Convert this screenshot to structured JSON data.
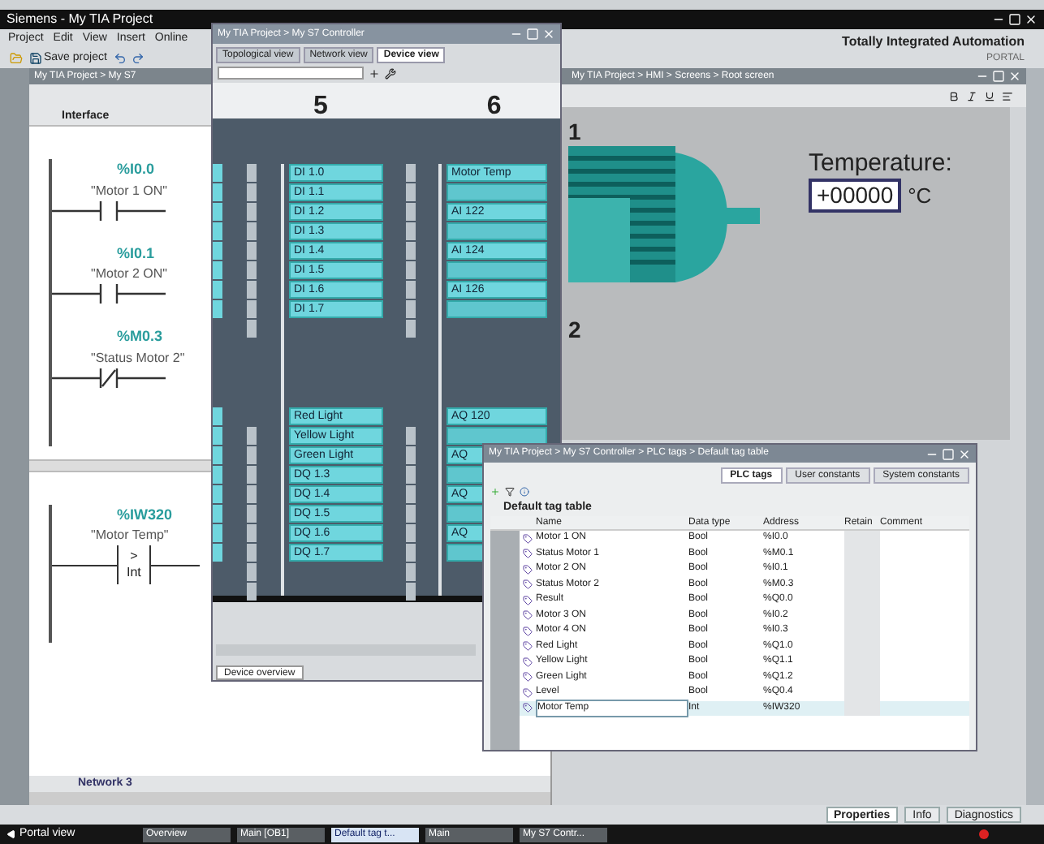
{
  "app_title": "Siemens - My TIA Project",
  "menu": [
    "Project",
    "Edit",
    "View",
    "Insert",
    "Online"
  ],
  "toolbar": {
    "save_label": "Save project"
  },
  "brand": {
    "title": "Totally Integrated Automation",
    "subtitle": "PORTAL"
  },
  "editor": {
    "breadcrumb": "My TIA Project > My S7",
    "section": "Interface",
    "networks": [
      {
        "rungs": [
          {
            "kind": "no",
            "address": "%I0.0",
            "tag": "\"Motor 1 ON\""
          },
          {
            "kind": "no",
            "address": "%I0.1",
            "tag": "\"Motor 2 ON\""
          },
          {
            "kind": "nc",
            "address": "%M0.3",
            "tag": "\"Status Motor 2\""
          }
        ]
      },
      {
        "rungs": [
          {
            "kind": "compare",
            "address": "%IW320",
            "tag": "\"Motor Temp\"",
            "op": ">",
            "type": "Int"
          }
        ]
      }
    ],
    "next_network": "Network 3"
  },
  "hmi": {
    "breadcrumb": "My TIA Project > HMI > Screens > Root screen",
    "markers": [
      "1",
      "2"
    ],
    "temperature_label": "Temperature:",
    "value": "+00000",
    "unit": "°C"
  },
  "device_window": {
    "title": "My TIA Project > My S7 Controller",
    "tabs": [
      {
        "label": "Topological view",
        "selected": false
      },
      {
        "label": "Network view",
        "selected": false
      },
      {
        "label": "Device view",
        "selected": true
      }
    ],
    "slots": [
      "5",
      "6"
    ],
    "modules": [
      {
        "groups": [
          [
            {
              "label": "DI 1.0"
            },
            {
              "label": "DI 1.1"
            },
            {
              "label": "DI 1.2"
            },
            {
              "label": "DI 1.3"
            },
            {
              "label": "DI 1.4"
            },
            {
              "label": "DI 1.5"
            },
            {
              "label": "DI 1.6"
            },
            {
              "label": "DI 1.7"
            }
          ],
          [
            {
              "label": "Red Light"
            },
            {
              "label": "Yellow Light"
            },
            {
              "label": "Green Light"
            },
            {
              "label": "DQ 1.3"
            },
            {
              "label": "DQ 1.4"
            },
            {
              "label": "DQ 1.5"
            },
            {
              "label": "DQ 1.6"
            },
            {
              "label": "DQ 1.7"
            }
          ]
        ]
      },
      {
        "groups": [
          [
            {
              "kind": "label",
              "label": "Motor Temp"
            },
            {
              "kind": "blank"
            },
            {
              "kind": "label",
              "label": "AI 122"
            },
            {
              "kind": "blank"
            },
            {
              "kind": "label",
              "label": "AI 124"
            },
            {
              "kind": "blank"
            },
            {
              "kind": "label",
              "label": "AI 126"
            },
            {
              "kind": "blank"
            }
          ],
          [
            {
              "kind": "label",
              "label": "AQ 120"
            },
            {
              "kind": "blank"
            },
            {
              "kind": "label",
              "label": "AQ"
            },
            {
              "kind": "blank"
            },
            {
              "kind": "label",
              "label": "AQ"
            },
            {
              "kind": "blank"
            },
            {
              "kind": "label",
              "label": "AQ"
            },
            {
              "kind": "blank"
            }
          ]
        ]
      }
    ],
    "overview_tab": "Device overview"
  },
  "tag_window": {
    "title": "My TIA Project > My S7 Controller > PLC tags > Default tag table",
    "tabs": [
      {
        "label": "PLC tags",
        "selected": true
      },
      {
        "label": "User constants",
        "selected": false
      },
      {
        "label": "System constants",
        "selected": false
      }
    ],
    "heading": "Default tag table",
    "columns": [
      "Name",
      "Data type",
      "Address",
      "Retain",
      "Comment"
    ],
    "rows": [
      {
        "name": "Motor 1 ON",
        "data_type": "Bool",
        "address": "%I0.0",
        "selected": false
      },
      {
        "name": "Status Motor 1",
        "data_type": "Bool",
        "address": "%M0.1",
        "selected": false
      },
      {
        "name": "Motor 2 ON",
        "data_type": "Bool",
        "address": "%I0.1",
        "selected": false
      },
      {
        "name": "Status Motor 2",
        "data_type": "Bool",
        "address": "%M0.3",
        "selected": false
      },
      {
        "name": "Result",
        "data_type": "Bool",
        "address": "%Q0.0",
        "selected": false
      },
      {
        "name": "Motor 3 ON",
        "data_type": "Bool",
        "address": "%I0.2",
        "selected": false
      },
      {
        "name": "Motor 4 ON",
        "data_type": "Bool",
        "address": "%I0.3",
        "selected": false
      },
      {
        "name": "Red Light",
        "data_type": "Bool",
        "address": "%Q1.0",
        "selected": false
      },
      {
        "name": "Yellow Light",
        "data_type": "Bool",
        "address": "%Q1.1",
        "selected": false
      },
      {
        "name": "Green Light",
        "data_type": "Bool",
        "address": "%Q1.2",
        "selected": false
      },
      {
        "name": "Level",
        "data_type": "Bool",
        "address": "%Q0.4",
        "selected": false
      },
      {
        "name": "Motor Temp",
        "data_type": "Int",
        "address": "%IW320",
        "selected": true
      }
    ]
  },
  "status_panels": [
    {
      "label": "Properties",
      "selected": true
    },
    {
      "label": "Info",
      "selected": false
    },
    {
      "label": "Diagnostics",
      "selected": false
    }
  ],
  "taskbar": {
    "portal_view": "Portal view",
    "items": [
      {
        "label": "Overview",
        "selected": false
      },
      {
        "label": "Main [OB1]",
        "selected": false
      },
      {
        "label": "Default tag t...",
        "selected": true
      },
      {
        "label": "Main",
        "selected": false
      },
      {
        "label": "My S7 Contr...",
        "selected": false
      }
    ]
  }
}
